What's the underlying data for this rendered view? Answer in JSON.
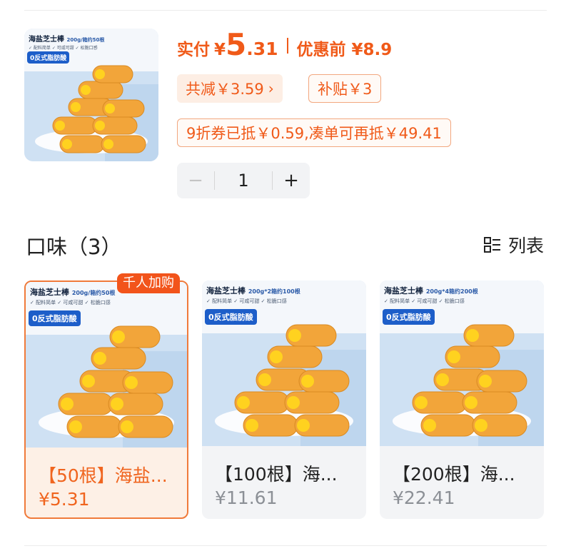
{
  "product": {
    "price_label": "实付",
    "currency": "¥",
    "price_int": "5",
    "price_dec": ".31",
    "original_label": "优惠前 ¥8.9",
    "discount_chip": "共减￥3.59",
    "subsidy_chip": "补贴￥3",
    "coupon_note": "9折券已抵￥0.59,凑单可再抵￥49.41",
    "quantity": "1",
    "minus": "−",
    "plus": "+"
  },
  "image_text": {
    "brand": "海盐芝士棒",
    "spec_50": "200g/箱约50根",
    "spec_100": "200g*2箱约100根",
    "spec_200": "200g*4箱约200根",
    "features": "✓ 配料简单 ✓ 可咸可甜 ✓ 松脆口感",
    "tag": "0反式脂肪酸"
  },
  "variants": {
    "title": "口味（3）",
    "view_toggle": "列表",
    "badge": "千人加购",
    "items": [
      {
        "name": "【50根】海盐...",
        "price": "¥5.31"
      },
      {
        "name": "【100根】海...",
        "price": "¥11.61"
      },
      {
        "name": "【200根】海...",
        "price": "¥22.41"
      }
    ]
  },
  "colors": {
    "accent": "#f05a19",
    "selected_bg": "#fdf0e6",
    "card_bg": "#f3f4f6"
  }
}
